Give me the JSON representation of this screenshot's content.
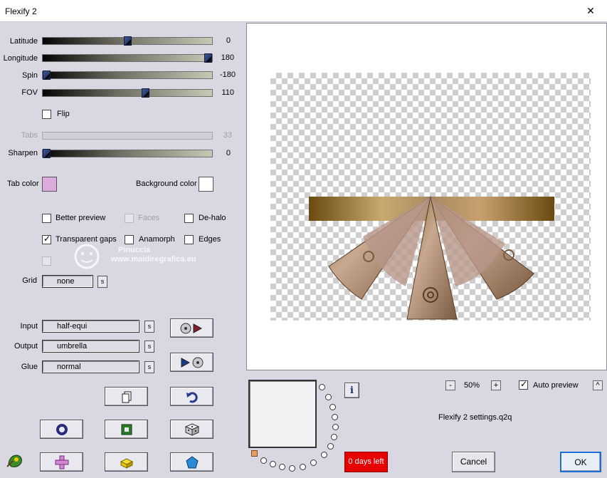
{
  "window": {
    "title": "Flexify 2",
    "close_symbol": "✕"
  },
  "sliders": [
    {
      "label": "Latitude",
      "value": "0",
      "fraction": 0.5,
      "disabled": false
    },
    {
      "label": "Longitude",
      "value": "180",
      "fraction": 1.0,
      "disabled": false
    },
    {
      "label": "Spin",
      "value": "-180",
      "fraction": 0.0,
      "disabled": false
    },
    {
      "label": "FOV",
      "value": "110",
      "fraction": 0.61,
      "disabled": false
    },
    {
      "label": "Tabs",
      "value": "33",
      "fraction": null,
      "disabled": true
    },
    {
      "label": "Sharpen",
      "value": "0",
      "fraction": 0.0,
      "disabled": false
    }
  ],
  "flip": {
    "label": "Flip",
    "checked": false
  },
  "colors": {
    "tab_color_label": "Tab color",
    "tab_color": "#dcaadc",
    "background_color_label": "Background color",
    "background_color": "#ffffff"
  },
  "options": {
    "better_preview": {
      "label": "Better preview",
      "checked": false
    },
    "faces": {
      "label": "Faces",
      "checked": false,
      "disabled": true
    },
    "de_halo": {
      "label": "De-halo",
      "checked": false
    },
    "transparent_gaps": {
      "label": "Transparent gaps",
      "checked": true
    },
    "anamorph": {
      "label": "Anamorph",
      "checked": false
    },
    "edges": {
      "label": "Edges",
      "checked": false
    }
  },
  "grid": {
    "label": "Grid",
    "value": "none",
    "s_button": "s"
  },
  "projections": {
    "input_label": "Input",
    "input_value": "half-equi",
    "output_label": "Output",
    "output_value": "umbrella",
    "glue_label": "Glue",
    "glue_value": "normal",
    "s_button": "s"
  },
  "watermark": {
    "line1": "Pinuccia",
    "line2": "www.maidiregrafica.eu"
  },
  "zoom": {
    "minus": "-",
    "value": "50%",
    "plus": "+"
  },
  "auto_preview": {
    "label": "Auto preview",
    "checked": true,
    "caret": "^"
  },
  "settings_file": "Flexify 2 settings.q2q",
  "trial": {
    "text": "0 days left"
  },
  "buttons": {
    "cancel": "Cancel",
    "ok": "OK",
    "info": "i"
  },
  "icon_colors": {
    "accent_purple": "#5a3a8a",
    "green": "#2a7a2a",
    "yellow": "#e8c800",
    "blue": "#1a6ed8",
    "pink": "#d488d4"
  }
}
